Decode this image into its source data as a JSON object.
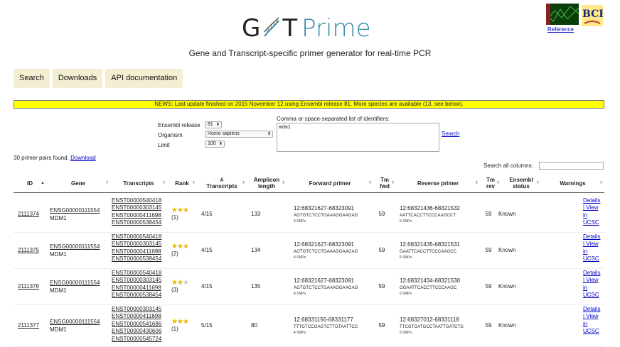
{
  "header": {
    "logo_g": "G",
    "logo_t": "T",
    "logo_prime": "Prime",
    "tagline": "Gene and Transcript-specific primer generator for real-time PCR",
    "reference_link": "Reference",
    "logo_secondary_letters": "BCF"
  },
  "nav": {
    "items": [
      "Search",
      "Downloads",
      "API documentation"
    ]
  },
  "news": "NEWS: Last update finished on 2015 November 12 using Ensembl release 81. More species are available (13, see below).",
  "form": {
    "ensembl_label": "Ensembl release",
    "ensembl_value": "81",
    "organism_label": "Organism",
    "organism_value": "Homo sapiens",
    "limit_label": "Limit",
    "limit_value": "100",
    "identifiers_label": "Comma or space-separated list of identifiers:",
    "identifiers_value": "mdm1",
    "search_link": "Search"
  },
  "results": {
    "found_text": "30 primer pairs found.",
    "download_link": "Download",
    "search_all_label": "Search all columns:"
  },
  "table": {
    "columns": [
      "ID",
      "Gene",
      "Transcripts",
      "Rank",
      "# Transcripts",
      "Amplicon length",
      "Forward primer",
      "Tm fwd",
      "Reverse primer",
      "Tm rev",
      "Ensembl status",
      "Warnings"
    ],
    "rows": [
      {
        "id": "2111374",
        "gene_id": "ENSG00000111554",
        "gene_name": "MDM1",
        "transcripts": [
          "ENST00000540418",
          "ENST00000303145",
          "ENST00000411698",
          "ENST00000538454"
        ],
        "rank": "(1)",
        "stars": 3,
        "n_transcripts": "4/15",
        "amplicon": "133",
        "fwd_pos": "12:68321627-68323091",
        "fwd_seq": "AGTGTCTCCTGAAAGGAAGAG",
        "fwd_snps": "4 SNPs",
        "tm_fwd": "59",
        "rev_pos": "12:68321436-68321532",
        "rev_seq": "AATTCACCTTCCCAAGCCT",
        "rev_snps": "5 SNPs",
        "tm_rev": "59",
        "status": "Known",
        "links": [
          "Details",
          "| View",
          "in",
          "UCSC"
        ]
      },
      {
        "id": "2111375",
        "gene_id": "ENSG00000111554",
        "gene_name": "MDM1",
        "transcripts": [
          "ENST00000540418",
          "ENST00000303145",
          "ENST00000411698",
          "ENST00000538454"
        ],
        "rank": "(2)",
        "stars": 2.5,
        "n_transcripts": "4/15",
        "amplicon": "134",
        "fwd_pos": "12:68321627-68323091",
        "fwd_seq": "AGTGTCTCCTGAAAGGAAGAG",
        "fwd_snps": "4 SNPs",
        "tm_fwd": "59",
        "rev_pos": "12:68321435-68321531",
        "rev_seq": "GAATTCACCTTCCCAAGCC",
        "rev_snps": "5 SNPs",
        "tm_rev": "59",
        "status": "Known",
        "links": [
          "Details",
          "| View",
          "in",
          "UCSC"
        ]
      },
      {
        "id": "2111376",
        "gene_id": "ENSG00000111554",
        "gene_name": "MDM1",
        "transcripts": [
          "ENST00000540418",
          "ENST00000303145",
          "ENST00000411698",
          "ENST00000538454"
        ],
        "rank": "(3)",
        "stars": 1.5,
        "n_transcripts": "4/15",
        "amplicon": "135",
        "fwd_pos": "12:68321627-68323091",
        "fwd_seq": "AGTGTCTCCTGAAAGGAAGAG",
        "fwd_snps": "4 SNPs",
        "tm_fwd": "59",
        "rev_pos": "12:68321434-68321530",
        "rev_seq": "GGAATTCACCTTCCCAAGC",
        "rev_snps": "6 SNPs",
        "tm_rev": "59",
        "status": "Known",
        "links": [
          "Details",
          "| View",
          "in",
          "UCSC"
        ]
      },
      {
        "id": "2111377",
        "gene_id": "ENSG00000111554",
        "gene_name": "MDM1",
        "transcripts": [
          "ENST00000303145",
          "ENST00000411698",
          "ENST00000541686",
          "ENST00000430606",
          "ENST00000545724"
        ],
        "rank": "(1)",
        "stars": 3,
        "n_transcripts": "5/15",
        "amplicon": "80",
        "fwd_pos": "12:68331156-68331177",
        "fwd_seq": "TTTGTCCGAGTCTTGTAATTCC",
        "fwd_snps": "4 SNPs",
        "tm_fwd": "59",
        "rev_pos": "12:68327012-68331118",
        "rev_seq": "TTCGTGATGCCTAATTGATCTG",
        "rev_snps": "5 SNPs",
        "tm_rev": "59",
        "status": "Known",
        "links": [
          "Details",
          "| View",
          "in",
          "UCSC"
        ]
      }
    ]
  },
  "colors": {
    "accent": "#2e8aa6",
    "nav_bg": "#f4efd3",
    "news_bg": "#ffff00",
    "link": "#0000cc",
    "star": "#e8b400"
  }
}
